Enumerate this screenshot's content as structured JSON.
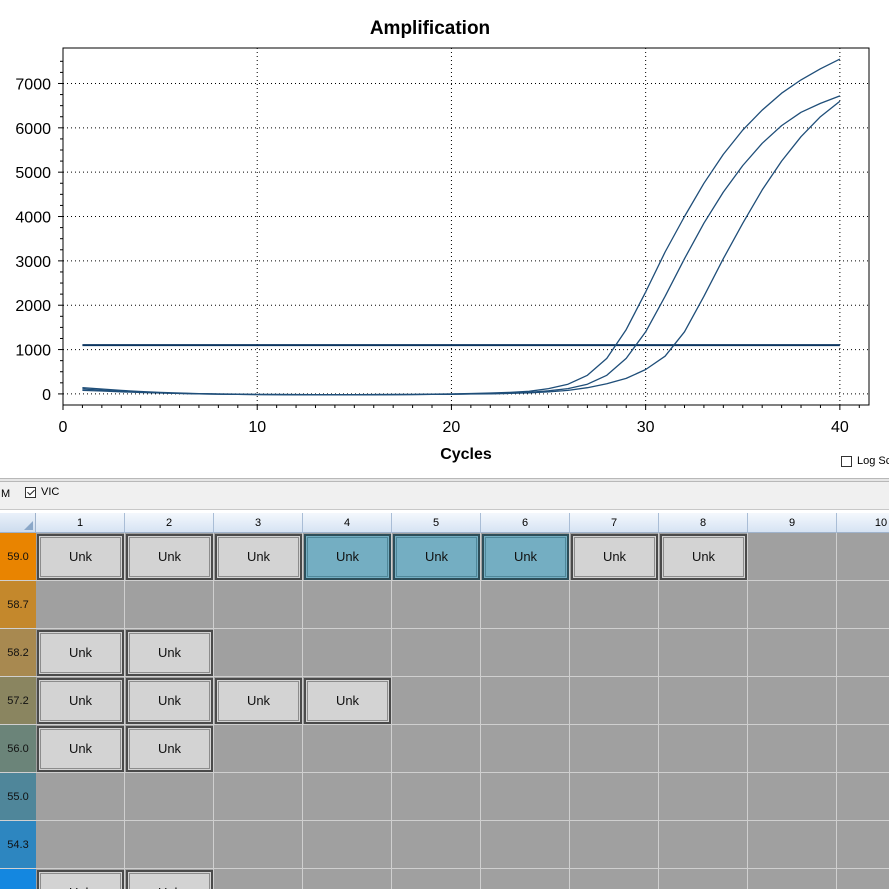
{
  "chart_data": {
    "type": "line",
    "title": "Amplification",
    "xlabel": "Cycles",
    "ylabel": "",
    "xlim": [
      0,
      41.5
    ],
    "ylim": [
      -250,
      7800
    ],
    "xticks": [
      0,
      10,
      20,
      30,
      40
    ],
    "yticks": [
      0,
      1000,
      2000,
      3000,
      4000,
      5000,
      6000,
      7000
    ],
    "grid": true,
    "line_color": "#1f4e79",
    "threshold": {
      "value": 1100,
      "x_range": [
        1,
        40
      ]
    },
    "series": [
      {
        "x": [
          1,
          2,
          3,
          4,
          5,
          6,
          7,
          8,
          9,
          10,
          11,
          12,
          13,
          14,
          15,
          16,
          17,
          18,
          19,
          20,
          21,
          22,
          23,
          24,
          25,
          26,
          27,
          28,
          29,
          30,
          31,
          32,
          33,
          34,
          35,
          36,
          37,
          38,
          39,
          40
        ],
        "values": [
          140,
          110,
          80,
          55,
          35,
          20,
          8,
          0,
          -5,
          -10,
          -12,
          -14,
          -15,
          -15,
          -15,
          -14,
          -12,
          -10,
          -5,
          0,
          10,
          20,
          35,
          60,
          120,
          220,
          420,
          800,
          1450,
          2300,
          3200,
          4000,
          4750,
          5400,
          5950,
          6400,
          6780,
          7080,
          7330,
          7550
        ]
      },
      {
        "x": [
          1,
          2,
          3,
          4,
          5,
          6,
          7,
          8,
          9,
          10,
          11,
          12,
          13,
          14,
          15,
          16,
          17,
          18,
          19,
          20,
          21,
          22,
          23,
          24,
          25,
          26,
          27,
          28,
          29,
          30,
          31,
          32,
          33,
          34,
          35,
          36,
          37,
          38,
          39,
          40
        ],
        "values": [
          110,
          85,
          60,
          40,
          25,
          12,
          3,
          -5,
          -10,
          -14,
          -16,
          -18,
          -19,
          -19,
          -19,
          -18,
          -16,
          -13,
          -10,
          -5,
          0,
          8,
          18,
          35,
          70,
          120,
          220,
          420,
          800,
          1400,
          2200,
          3050,
          3850,
          4550,
          5150,
          5650,
          6050,
          6350,
          6550,
          6720
        ]
      },
      {
        "x": [
          1,
          2,
          3,
          4,
          5,
          6,
          7,
          8,
          9,
          10,
          11,
          12,
          13,
          14,
          15,
          16,
          17,
          18,
          19,
          20,
          21,
          22,
          23,
          24,
          25,
          26,
          27,
          28,
          29,
          30,
          31,
          32,
          33,
          34,
          35,
          36,
          37,
          38,
          39,
          40
        ],
        "values": [
          80,
          65,
          48,
          32,
          20,
          10,
          2,
          -6,
          -12,
          -16,
          -18,
          -20,
          -21,
          -21,
          -21,
          -20,
          -18,
          -15,
          -12,
          -8,
          -3,
          3,
          12,
          25,
          45,
          80,
          140,
          230,
          350,
          550,
          850,
          1400,
          2200,
          3050,
          3850,
          4600,
          5250,
          5800,
          6250,
          6600
        ]
      }
    ]
  },
  "options": {
    "log_scale_label": "Log Sc",
    "log_scale_checked": false
  },
  "dye_bar": {
    "prev_label": "M",
    "vic_label": "VIC",
    "vic_checked": true
  },
  "plate": {
    "columns": [
      "1",
      "2",
      "3",
      "4",
      "5",
      "6",
      "7",
      "8",
      "9",
      "10"
    ],
    "rows": [
      {
        "temp": "59.0",
        "color": "#e98400",
        "wells": [
          "Unk",
          "Unk",
          "Unk",
          "Unk",
          "Unk",
          "Unk",
          "Unk",
          "Unk"
        ],
        "selected": [
          3,
          4,
          5
        ]
      },
      {
        "temp": "58.7",
        "color": "#c4882c",
        "wells": [],
        "selected": []
      },
      {
        "temp": "58.2",
        "color": "#a88950",
        "wells": [
          "Unk",
          "Unk"
        ],
        "selected": []
      },
      {
        "temp": "57.2",
        "color": "#8a8560",
        "wells": [
          "Unk",
          "Unk",
          "Unk",
          "Unk"
        ],
        "selected": []
      },
      {
        "temp": "56.0",
        "color": "#6b8479",
        "wells": [
          "Unk",
          "Unk"
        ],
        "selected": []
      },
      {
        "temp": "55.0",
        "color": "#4f869a",
        "wells": [],
        "selected": []
      },
      {
        "temp": "54.3",
        "color": "#2d86c0",
        "wells": [],
        "selected": []
      },
      {
        "temp": "",
        "color": "#1487e0",
        "wells": [
          "Unk",
          "Unk"
        ],
        "selected": []
      }
    ]
  }
}
